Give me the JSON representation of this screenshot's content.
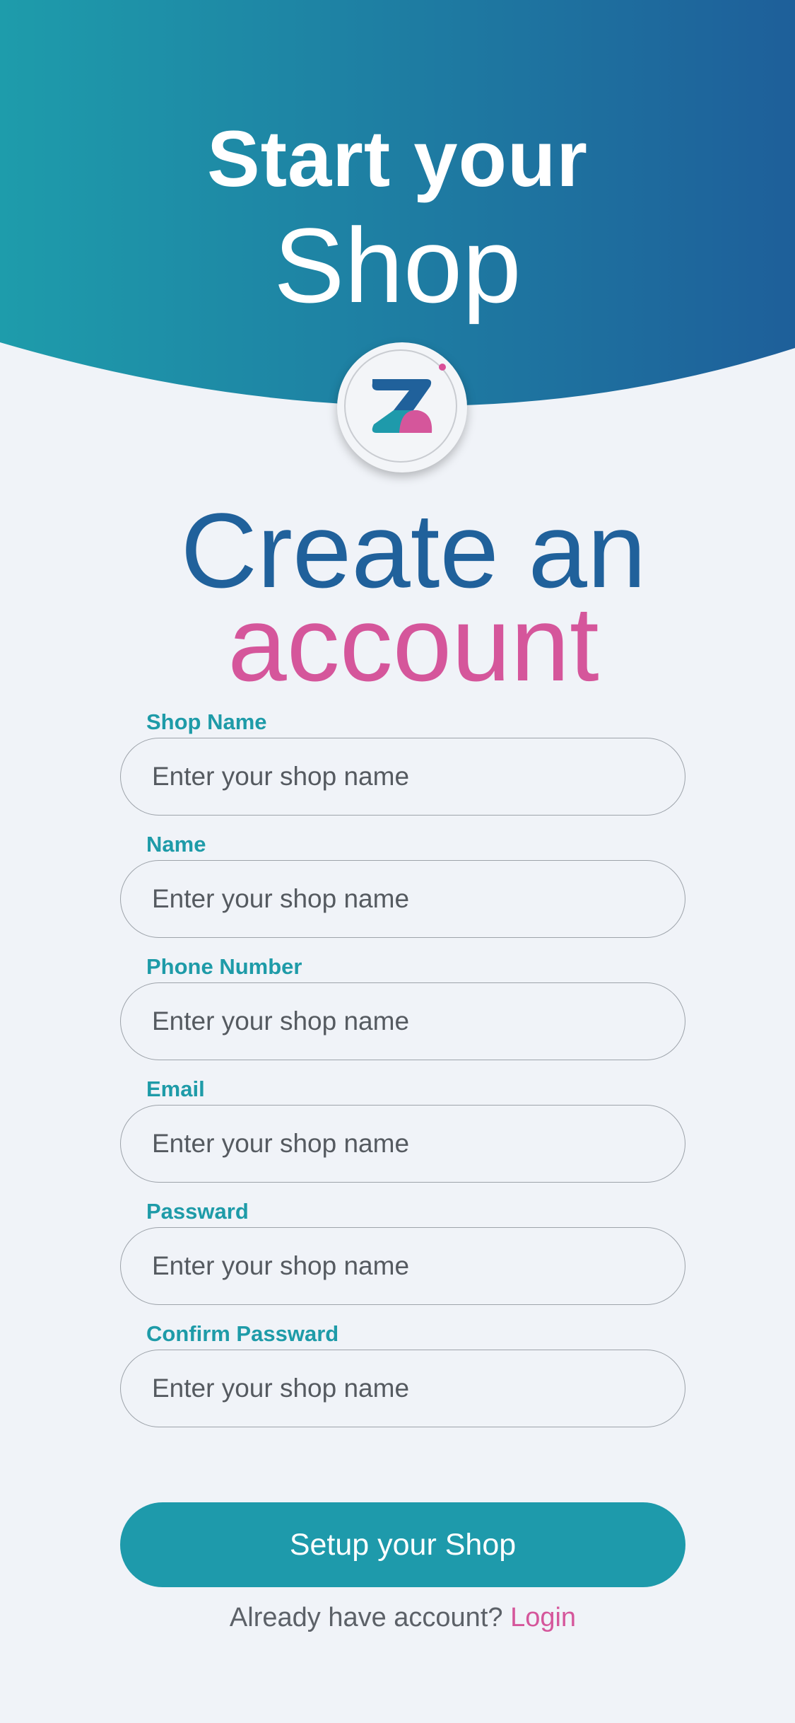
{
  "header": {
    "title_line1": "Start your",
    "title_line2": "Shop"
  },
  "logo": {
    "name": "z-logo"
  },
  "heading": {
    "line1": "Create an",
    "line2": "account"
  },
  "form": {
    "fields": [
      {
        "label": "Shop Name",
        "placeholder": "Enter your shop name"
      },
      {
        "label": "Name",
        "placeholder": "Enter your shop name"
      },
      {
        "label": "Phone Number",
        "placeholder": "Enter your shop name"
      },
      {
        "label": "Email",
        "placeholder": "Enter your shop name"
      },
      {
        "label": "Passward",
        "placeholder": "Enter your shop name"
      },
      {
        "label": "Confirm Passward",
        "placeholder": "Enter your shop name"
      }
    ],
    "submit_label": "Setup your Shop"
  },
  "footer": {
    "prompt": "Already have account?",
    "login_label": "Login"
  },
  "colors": {
    "gradient_start": "#1e9cab",
    "gradient_end": "#1e5f9a",
    "heading_blue": "#20619b",
    "accent_pink": "#d5569b",
    "teal": "#1e9aab",
    "background": "#f0f3f8"
  }
}
